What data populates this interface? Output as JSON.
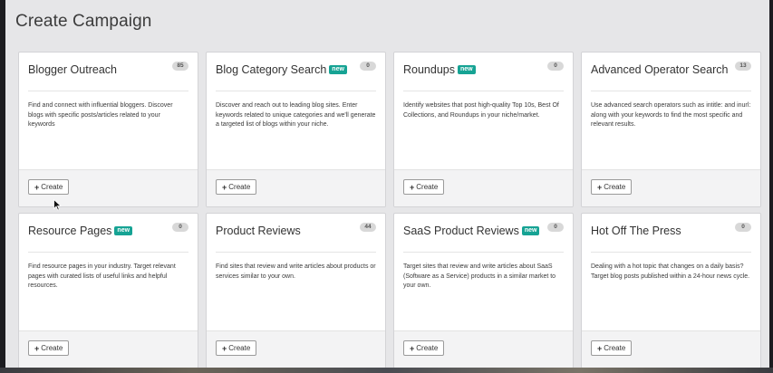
{
  "page": {
    "title": "Create Campaign"
  },
  "cards": [
    {
      "title": "Blogger Outreach",
      "is_new": false,
      "count": "85",
      "description": "Find and connect with influential bloggers. Discover blogs with specific posts/articles related to your keywords",
      "button": "Create"
    },
    {
      "title": "Blog Category Search",
      "is_new": true,
      "count": "0",
      "description": "Discover and reach out to leading blog sites. Enter keywords related to unique categories and we'll generate a targeted list of blogs within your niche.",
      "button": "Create"
    },
    {
      "title": "Roundups",
      "is_new": true,
      "count": "0",
      "description": "Identify websites that post high-quality Top 10s, Best Of Collections, and Roundups in your niche/market.",
      "button": "Create"
    },
    {
      "title": "Advanced Operator Search",
      "is_new": false,
      "count": "13",
      "description": "Use advanced search operators such as intitle: and inurl: along with your keywords to find the most specific and relevant results.",
      "button": "Create"
    },
    {
      "title": "Resource Pages",
      "is_new": true,
      "count": "0",
      "description": "Find resource pages in your industry. Target relevant pages with curated lists of useful links and helpful resources.",
      "button": "Create"
    },
    {
      "title": "Product Reviews",
      "is_new": false,
      "count": "44",
      "description": "Find sites that review and write articles about products or services similar to your own.",
      "button": "Create"
    },
    {
      "title": "SaaS Product Reviews",
      "is_new": true,
      "count": "0",
      "description": "Target sites that review and write articles about SaaS (Software as a Service) products in a similar market to your own.",
      "button": "Create"
    },
    {
      "title": "Hot Off The Press",
      "is_new": false,
      "count": "0",
      "description": "Dealing with a hot topic that changes on a daily basis? Target blog posts published within a 24-hour news cycle.",
      "button": "Create"
    }
  ],
  "labels": {
    "new_tag": "new",
    "plus_icon": "+"
  },
  "colors": {
    "new_tag": "#16a394",
    "background": "#e6e6e8",
    "card": "#ffffff"
  }
}
